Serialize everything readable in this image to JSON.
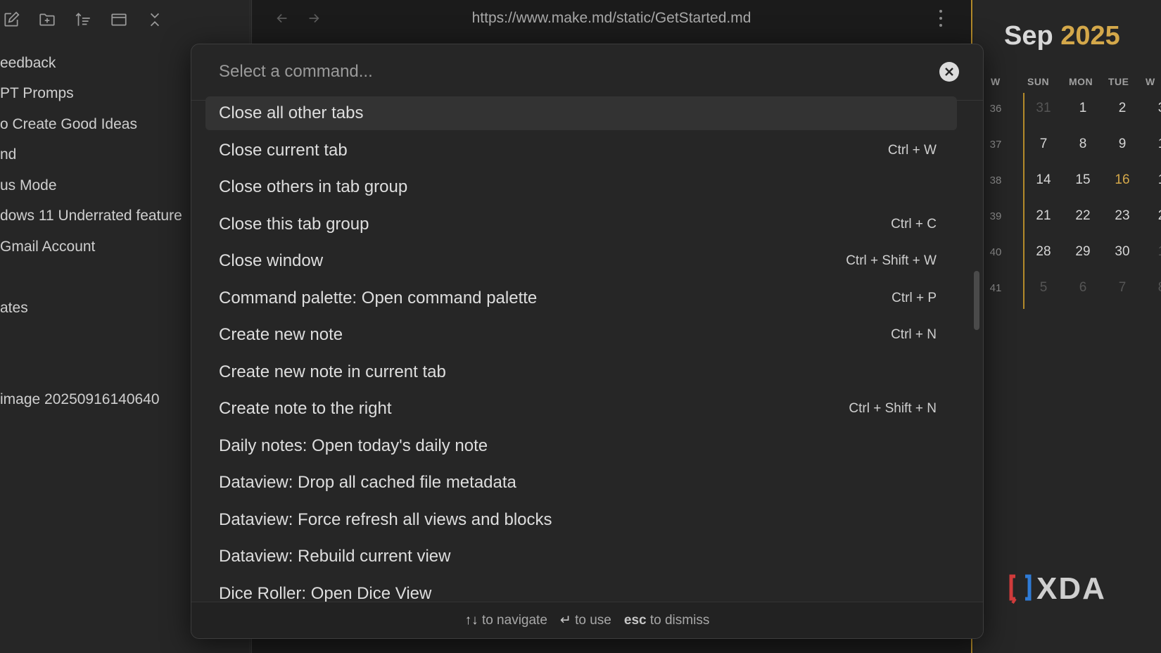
{
  "sidebar": {
    "toolbar_icons": [
      "new-note-icon",
      "new-folder-icon",
      "sort-icon",
      "collapse-icon",
      "close-icon"
    ],
    "files": [
      "eedback",
      "PT Promps",
      "o Create Good Ideas",
      "nd",
      "us Mode",
      "dows 11 Underrated feature",
      " Gmail Account",
      "ates",
      " image 20250916140640"
    ]
  },
  "main": {
    "url": "https://www.make.md/static/GetStarted.md"
  },
  "calendar": {
    "month": "Sep",
    "year": "2025",
    "headers": [
      "W",
      "SUN",
      "MON",
      "TUE",
      "W"
    ],
    "weeks": [
      {
        "wk": "36",
        "days": [
          "31",
          "1",
          "2",
          "3"
        ],
        "dim": [
          true,
          false,
          false,
          false
        ]
      },
      {
        "wk": "37",
        "days": [
          "7",
          "8",
          "9",
          "1"
        ],
        "dim": [
          false,
          false,
          false,
          false
        ]
      },
      {
        "wk": "38",
        "days": [
          "14",
          "15",
          "16",
          "1"
        ],
        "dim": [
          false,
          false,
          false,
          false
        ]
      },
      {
        "wk": "39",
        "days": [
          "21",
          "22",
          "23",
          "2"
        ],
        "dim": [
          false,
          false,
          false,
          false
        ]
      },
      {
        "wk": "40",
        "days": [
          "28",
          "29",
          "30",
          "1"
        ],
        "dim": [
          false,
          false,
          false,
          true
        ]
      },
      {
        "wk": "41",
        "days": [
          "5",
          "6",
          "7",
          "8"
        ],
        "dim": [
          true,
          true,
          true,
          true
        ]
      }
    ],
    "today": "16",
    "accent": "#d4a84a"
  },
  "watermark": "XDA",
  "palette": {
    "placeholder": "Select a command...",
    "commands": [
      {
        "label": "Close all other tabs",
        "hotkey": ""
      },
      {
        "label": "Close current tab",
        "hotkey": "Ctrl + W"
      },
      {
        "label": "Close others in tab group",
        "hotkey": ""
      },
      {
        "label": "Close this tab group",
        "hotkey": "Ctrl + C"
      },
      {
        "label": "Close window",
        "hotkey": "Ctrl + Shift + W"
      },
      {
        "label": "Command palette: Open command palette",
        "hotkey": "Ctrl + P"
      },
      {
        "label": "Create new note",
        "hotkey": "Ctrl + N"
      },
      {
        "label": "Create new note in current tab",
        "hotkey": ""
      },
      {
        "label": "Create note to the right",
        "hotkey": "Ctrl + Shift + N"
      },
      {
        "label": "Daily notes: Open today's daily note",
        "hotkey": ""
      },
      {
        "label": "Dataview: Drop all cached file metadata",
        "hotkey": ""
      },
      {
        "label": "Dataview: Force refresh all views and blocks",
        "hotkey": ""
      },
      {
        "label": "Dataview: Rebuild current view",
        "hotkey": ""
      },
      {
        "label": "Dice Roller: Open Dice View",
        "hotkey": ""
      }
    ],
    "selected_index": 0,
    "footer": {
      "nav_keys": "↑↓",
      "nav_text": "to navigate",
      "use_key": "↵",
      "use_text": "to use",
      "esc_key": "esc",
      "esc_text": "to dismiss"
    }
  }
}
